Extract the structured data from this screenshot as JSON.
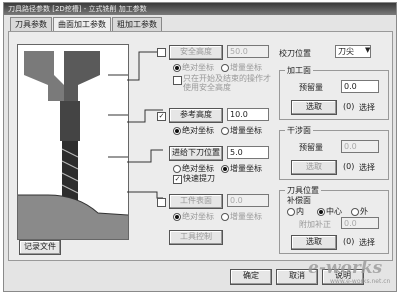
{
  "window": {
    "title": "刀具路径参数 [2D挖槽] - 立式铣削 加工参数"
  },
  "tabs": [
    {
      "label": "刀具参数"
    },
    {
      "label": "曲面加工参数"
    },
    {
      "label": "粗加工参数"
    }
  ],
  "left": {
    "safe_height": {
      "label": "安全高度",
      "value": "50.0",
      "abs": "绝对坐标",
      "inc": "增量坐标",
      "note": "只在开始及结束的操作才使用安全高度"
    },
    "retract_height": {
      "label": "参考高度",
      "value": "10.0",
      "abs": "绝对坐标",
      "inc": "增量坐标"
    },
    "feed_plane": {
      "label": "进给下刀位置",
      "value": "5.0",
      "abs": "绝对坐标",
      "inc": "增量坐标",
      "fast": "快速提刀"
    },
    "surface_height": {
      "label": "工件表面",
      "value": "0.0",
      "abs": "绝对坐标",
      "inc": "增量坐标"
    },
    "record_button": "记录文件",
    "tool_button": "工具控制"
  },
  "right": {
    "tip_comp": {
      "label": "校刀位置",
      "value": "刀尖"
    },
    "stock_to_leave": {
      "title": "加工面",
      "label": "预留量",
      "value": "0.0",
      "button": "选取",
      "count": "(0)",
      "suffix": "选择"
    },
    "check_surface": {
      "title": "干涉面",
      "label": "预留量",
      "value": "0.0",
      "button": "选取",
      "count": "(0)",
      "suffix": "选择"
    },
    "tool_containment": {
      "title": "刀具位置",
      "label": "补偿面",
      "options": [
        "内",
        "中心",
        "外"
      ],
      "selected": 1,
      "offset_label": "附加补正",
      "offset_value": "0.0",
      "button": "选取",
      "count": "(0)",
      "suffix": "选择"
    }
  },
  "footer": {
    "ok": "确定",
    "cancel": "取消",
    "help": "说明"
  },
  "watermark": {
    "brand": "e-works",
    "url": "www.e-works.net.cn"
  }
}
